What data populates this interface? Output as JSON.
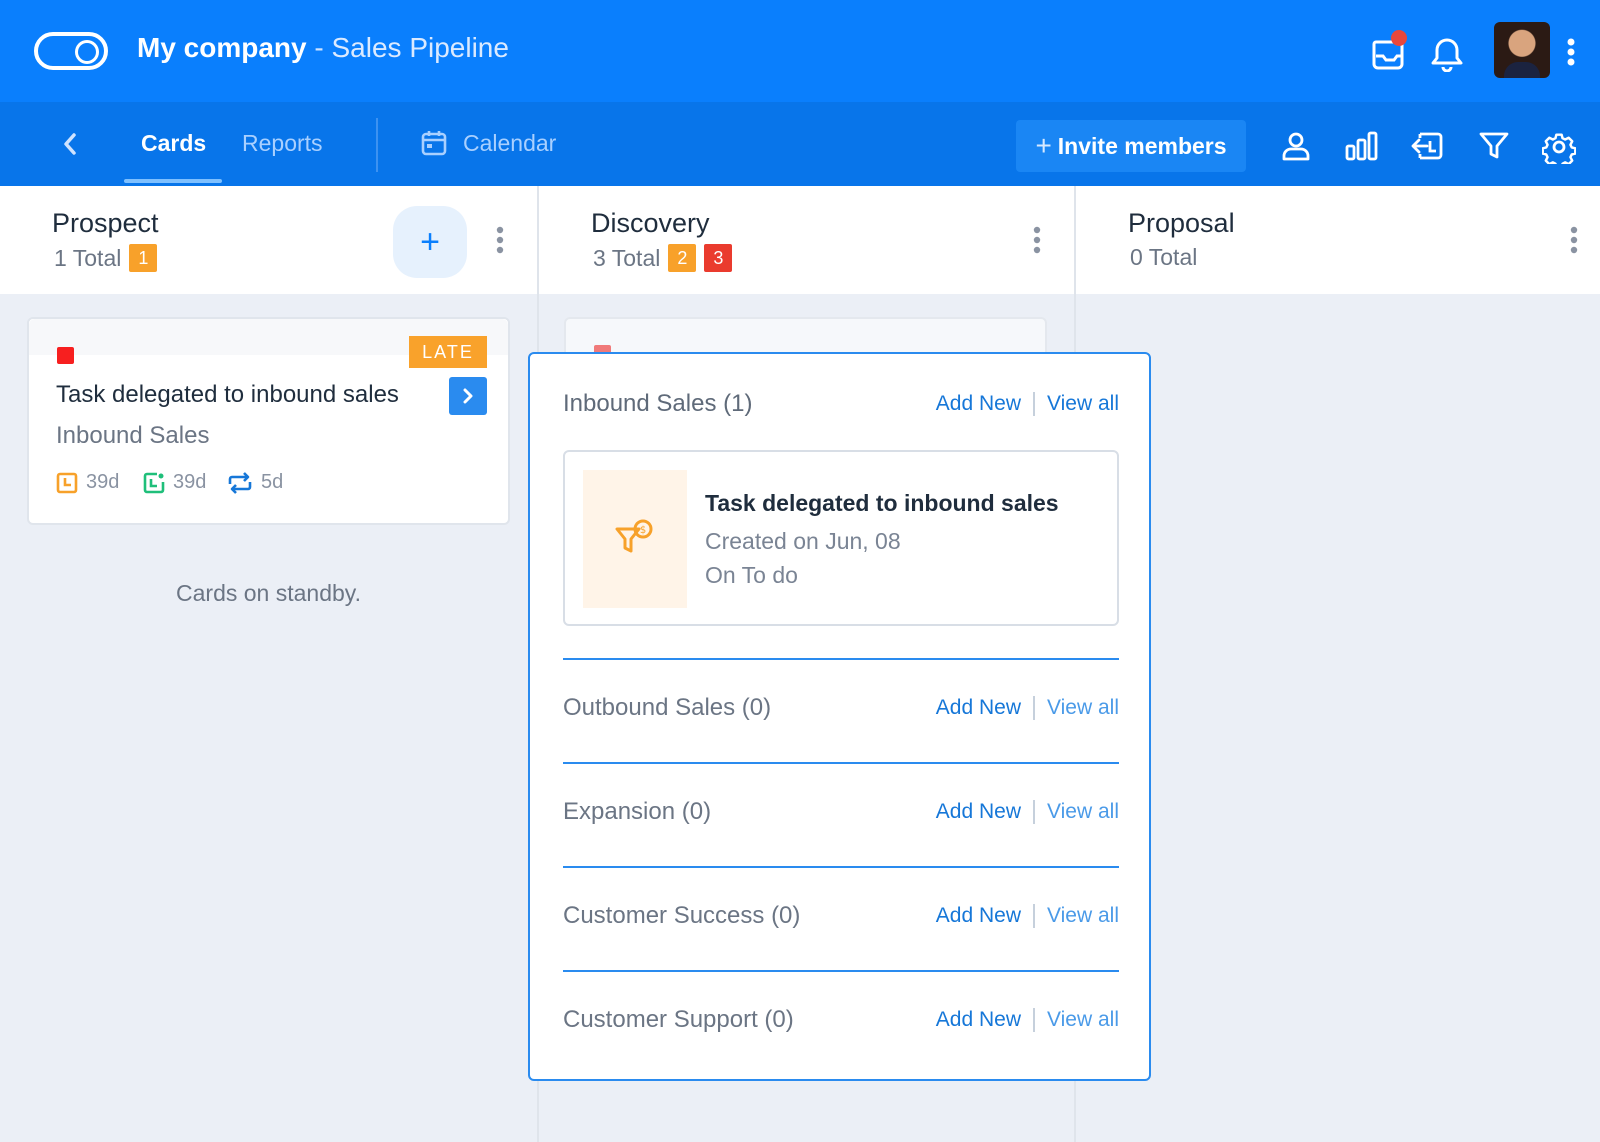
{
  "header": {
    "company": "My company",
    "separator": "-",
    "pipeline": "Sales Pipeline",
    "icons": [
      "toggle-logo-icon",
      "inbox-icon",
      "bell-icon",
      "avatar",
      "kebab-icon"
    ],
    "notification_dot_color": "#e8473c"
  },
  "subnav": {
    "tabs": [
      {
        "label": "Cards",
        "active": true
      },
      {
        "label": "Reports",
        "active": false
      },
      {
        "label": "Calendar",
        "active": false
      }
    ],
    "invite_plus": "+",
    "invite_label": "Invite members",
    "icons": [
      "user-icon",
      "bar-chart-icon",
      "export-icon",
      "filter-icon",
      "gear-icon"
    ]
  },
  "columns": [
    {
      "title": "Prospect",
      "total": "1 Total",
      "badges": [
        "1"
      ],
      "add_label": "+"
    },
    {
      "title": "Discovery",
      "total": "3 Total",
      "badges": [
        "2",
        "3"
      ]
    },
    {
      "title": "Proposal",
      "total": "0 Total",
      "badges": []
    }
  ],
  "card": {
    "status": "LATE",
    "title": "Task delegated to inbound sales",
    "subtitle": "Inbound Sales",
    "meta": [
      {
        "icon": "clock-icon",
        "value": "39d"
      },
      {
        "icon": "calendar-check-icon",
        "value": "39d"
      },
      {
        "icon": "repeat-icon",
        "value": "5d"
      }
    ]
  },
  "standby": "Cards on standby.",
  "popup": {
    "add_new": "Add New",
    "view_all": "View all",
    "groups": [
      {
        "name": "Inbound Sales (1)"
      },
      {
        "name": "Outbound Sales (0)"
      },
      {
        "name": "Expansion (0)"
      },
      {
        "name": "Customer Success (0)"
      },
      {
        "name": "Customer Support (0)"
      }
    ],
    "task": {
      "title": "Task delegated to inbound sales",
      "created": "Created on Jun, 08",
      "status": "On To do",
      "icon": "funnel-money-icon"
    }
  },
  "colors": {
    "primary": "#0a7ffd",
    "subnav": "#0875ea",
    "late": "#f9a22b",
    "badge_red": "#ea3b2e",
    "label_red": "#f71f1f"
  }
}
